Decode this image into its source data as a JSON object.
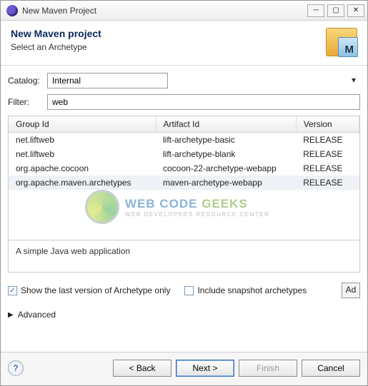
{
  "window": {
    "title": "New Maven Project"
  },
  "header": {
    "title": "New Maven project",
    "subtitle": "Select an Archetype"
  },
  "fields": {
    "catalog_label": "Catalog:",
    "catalog_value": "Internal",
    "filter_label": "Filter:",
    "filter_value": "web"
  },
  "table": {
    "headers": {
      "group": "Group Id",
      "artifact": "Artifact Id",
      "version": "Version"
    },
    "rows": [
      {
        "group": "net.liftweb",
        "artifact": "lift-archetype-basic",
        "version": "RELEASE",
        "selected": false
      },
      {
        "group": "net.liftweb",
        "artifact": "lift-archetype-blank",
        "version": "RELEASE",
        "selected": false
      },
      {
        "group": "org.apache.cocoon",
        "artifact": "cocoon-22-archetype-webapp",
        "version": "RELEASE",
        "selected": false
      },
      {
        "group": "org.apache.maven.archetypes",
        "artifact": "maven-archetype-webapp",
        "version": "RELEASE",
        "selected": true
      }
    ]
  },
  "description": "A simple Java web application",
  "options": {
    "show_last_label": "Show the last version of Archetype only",
    "show_last_checked": true,
    "include_snapshot_label": "Include snapshot archetypes",
    "include_snapshot_checked": false,
    "add_label": "Ad"
  },
  "advanced_label": "Advanced",
  "buttons": {
    "back": "< Back",
    "next": "Next >",
    "finish": "Finish",
    "cancel": "Cancel"
  },
  "watermark": {
    "line1_a": "WEB CODE ",
    "line1_b": "GEEKS",
    "line2": "WEB DEVELOPERS RESOURCE CENTER"
  }
}
